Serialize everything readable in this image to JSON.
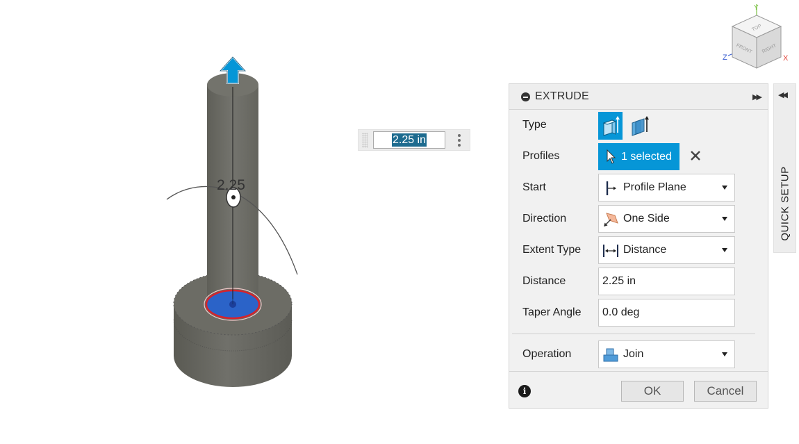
{
  "viewcube": {
    "face_top": "TOP",
    "face_front": "FRONT",
    "face_right": "RIGHT",
    "axis_x": "X",
    "axis_y": "Y",
    "axis_z": "Z",
    "colors": {
      "x": "#e2453c",
      "y": "#7ac142",
      "z": "#3b5fd1"
    }
  },
  "canvas": {
    "dimension_label": "2.25",
    "manipulator_value": "2.25 in"
  },
  "panel": {
    "title": "EXTRUDE",
    "rows": {
      "type": {
        "label": "Type",
        "options": [
          "solid",
          "surface"
        ],
        "selected": "solid"
      },
      "profiles": {
        "label": "Profiles",
        "value": "1 selected"
      },
      "start": {
        "label": "Start",
        "value": "Profile Plane",
        "icon": "profile-plane-icon"
      },
      "direction": {
        "label": "Direction",
        "value": "One Side",
        "icon": "one-side-icon"
      },
      "extent_type": {
        "label": "Extent Type",
        "value": "Distance",
        "icon": "distance-icon"
      },
      "distance": {
        "label": "Distance",
        "value": "2.25 in"
      },
      "taper_angle": {
        "label": "Taper Angle",
        "value": "0.0 deg"
      },
      "operation": {
        "label": "Operation",
        "value": "Join",
        "icon": "join-icon"
      }
    },
    "ok_label": "OK",
    "cancel_label": "Cancel"
  },
  "side_tab": {
    "label": "QUICK SETUP"
  },
  "colors": {
    "accent": "#0696d7",
    "selection": "#1d6b8f",
    "model": "#6b6b63",
    "profile_fill": "#2b63c8",
    "profile_edge": "#d8222a"
  }
}
